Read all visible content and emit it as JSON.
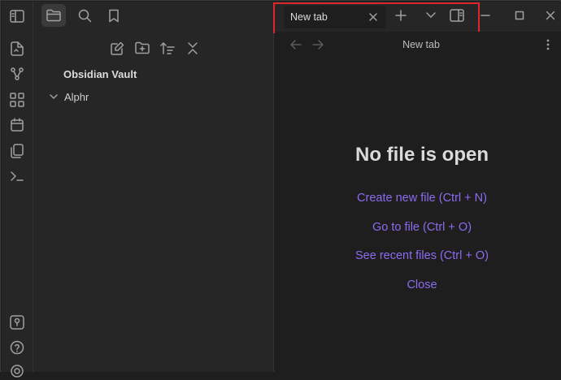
{
  "sidebar": {
    "vault_name": "Obsidian Vault",
    "folders": [
      {
        "label": "Alphr"
      }
    ]
  },
  "tabs": [
    {
      "label": "New tab"
    }
  ],
  "view": {
    "header_title": "New tab",
    "empty_state": {
      "title": "No file is open",
      "actions": [
        {
          "label": "Create new file (Ctrl + N)"
        },
        {
          "label": "Go to file (Ctrl + O)"
        },
        {
          "label": "See recent files (Ctrl + O)"
        },
        {
          "label": "Close"
        }
      ]
    }
  },
  "colors": {
    "link": "#8c6cf0",
    "highlight": "#e0262a",
    "background": "#1e1e1e",
    "sidebar": "#262626"
  }
}
